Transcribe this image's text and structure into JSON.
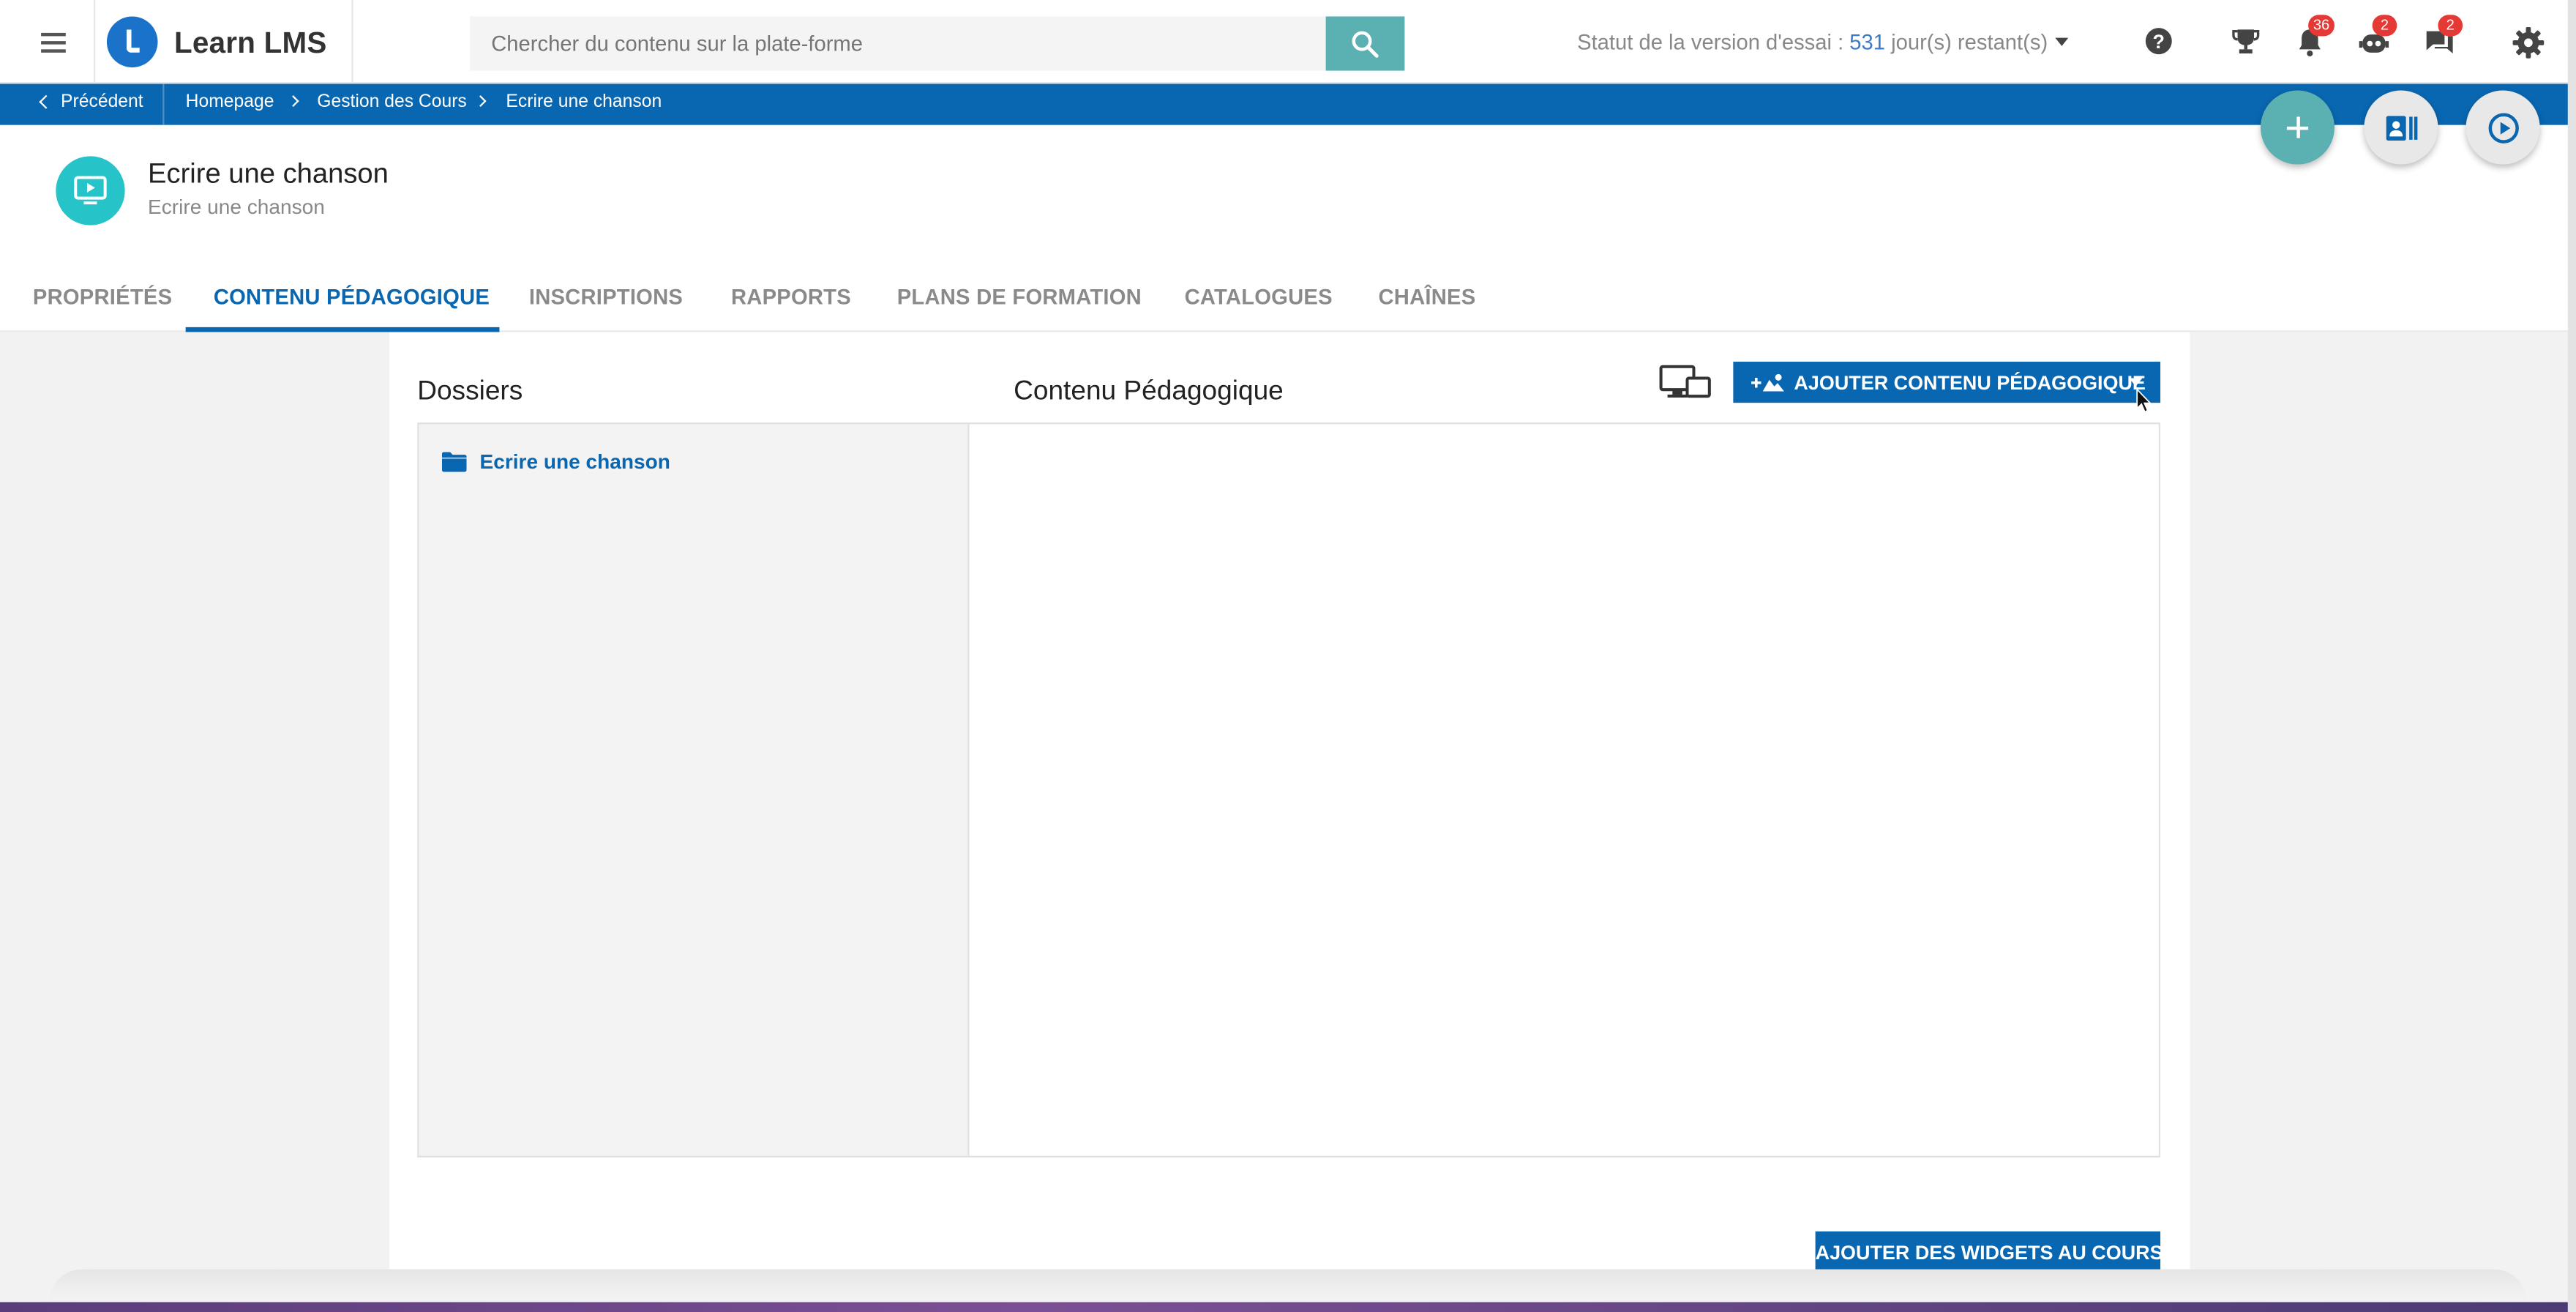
{
  "app": {
    "brand": "Learn LMS"
  },
  "search": {
    "placeholder": "Chercher du contenu sur la plate-forme"
  },
  "trial": {
    "prefix": "Statut de la version d'essai : ",
    "days": "531",
    "suffix": " jour(s) restant(s)"
  },
  "header_icons": {
    "help": "help-icon",
    "trophy": "trophy-icon",
    "notifications_badge": "36",
    "assistant_badge": "2",
    "messages_badge": "2",
    "settings": "gear-icon"
  },
  "breadcrumb": {
    "back": "Précédent",
    "items": [
      "Homepage",
      "Gestion des Cours",
      "Ecrire une chanson"
    ]
  },
  "course": {
    "title": "Ecrire une chanson",
    "subtitle": "Ecrire une chanson"
  },
  "tabs": [
    {
      "label": "PROPRIÉTÉS"
    },
    {
      "label": "CONTENU PÉDAGOGIQUE"
    },
    {
      "label": "INSCRIPTIONS"
    },
    {
      "label": "RAPPORTS"
    },
    {
      "label": "PLANS DE FORMATION"
    },
    {
      "label": "CATALOGUES"
    },
    {
      "label": "CHAÎNES"
    }
  ],
  "active_tab": "CONTENU PÉDAGOGIQUE",
  "main": {
    "folders_title": "Dossiers",
    "content_title": "Contenu Pédagogique",
    "add_content_label": "AJOUTER CONTENU PÉDAGOGIQUE",
    "folders": [
      {
        "label": "Ecrire une chanson"
      }
    ],
    "add_widgets_label": "AJOUTER DES WIDGETS AU COURS"
  },
  "colors": {
    "primary": "#0966b0",
    "accent_teal": "#5bb1b1",
    "course_icon": "#26c4c9",
    "badge": "#e53935"
  }
}
